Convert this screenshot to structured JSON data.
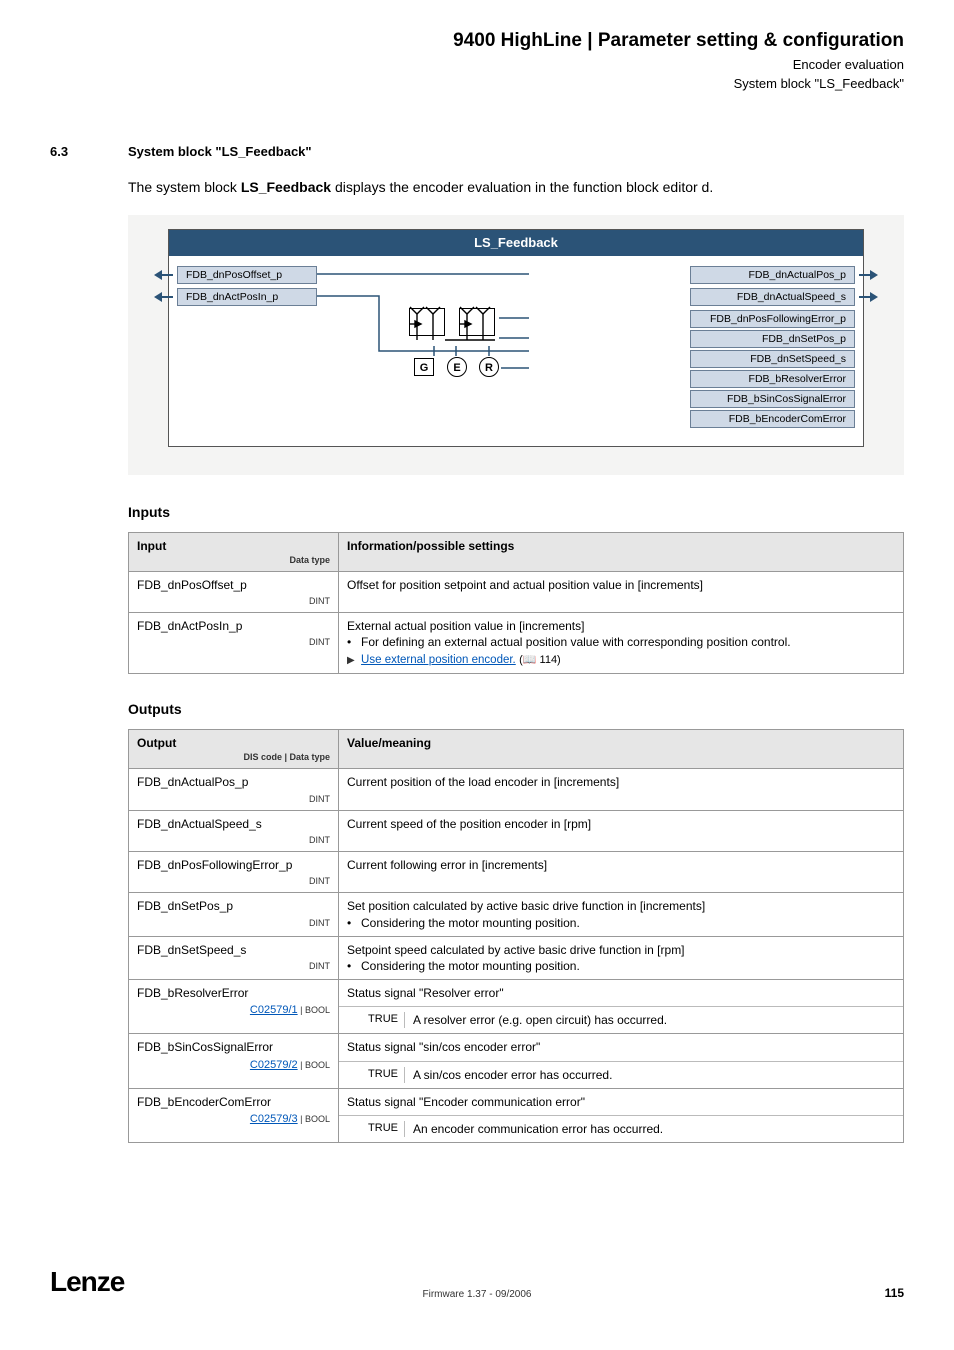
{
  "header": {
    "title": "9400 HighLine | Parameter setting & configuration",
    "subtitle1": "Encoder evaluation",
    "subtitle2": "System block \"LS_Feedback\""
  },
  "section": {
    "number": "6.3",
    "heading": "System block \"LS_Feedback\""
  },
  "intro": {
    "pre": "The system block ",
    "bold": "LS_Feedback",
    "post": " displays the encoder evaluation in the function block editor d."
  },
  "diagram": {
    "title": "LS_Feedback",
    "inputs": [
      "FDB_dnPosOffset_p",
      "FDB_dnActPosIn_p"
    ],
    "outputs": [
      "FDB_dnActualPos_p",
      "FDB_dnActualSpeed_s",
      "FDB_dnPosFollowingError_p",
      "FDB_dnSetPos_p",
      "FDB_dnSetSpeed_s",
      "FDB_bResolverError",
      "FDB_bSinCosSignalError",
      "FDB_bEncoderComError"
    ],
    "ger": [
      "G",
      "E",
      "R"
    ]
  },
  "inputs_head": "Inputs",
  "inputs_table": {
    "h1": "Input",
    "h1sub": "Data type",
    "h2": "Information/possible settings",
    "rows": [
      {
        "name": "FDB_dnPosOffset_p",
        "dtype": "DINT",
        "info_plain": "Offset for position setpoint and actual position value in [increments]"
      },
      {
        "name": "FDB_dnActPosIn_p",
        "dtype": "DINT",
        "info_line1": "External actual position value in [increments]",
        "info_bullet": "For defining an external actual position value with corresponding position control.",
        "info_link": "Use external position encoder.",
        "info_link_page": "(📖 114)"
      }
    ]
  },
  "outputs_head": "Outputs",
  "outputs_table": {
    "h1": "Output",
    "h1sub": "DIS code | Data type",
    "h2": "Value/meaning",
    "rows": [
      {
        "name": "FDB_dnActualPos_p",
        "dtype": "DINT",
        "val": "Current position of the load encoder in [increments]"
      },
      {
        "name": "FDB_dnActualSpeed_s",
        "dtype": "DINT",
        "val": "Current speed of the position encoder in [rpm]"
      },
      {
        "name": "FDB_dnPosFollowingError_p",
        "dtype": "DINT",
        "val": "Current following error in [increments]"
      },
      {
        "name": "FDB_dnSetPos_p",
        "dtype": "DINT",
        "val": "Set position calculated by active basic drive function in [increments]",
        "bullet": "Considering the motor mounting position."
      },
      {
        "name": "FDB_dnSetSpeed_s",
        "dtype": "DINT",
        "val": "Setpoint speed calculated by active basic drive function in [rpm]",
        "bullet": "Considering the motor mounting position."
      },
      {
        "name": "FDB_bResolverError",
        "code": "C02579/1",
        "dtype": "BOOL",
        "status": "Status signal \"Resolver error\"",
        "truelab": "TRUE",
        "truetxt": "A resolver error (e.g. open circuit) has occurred."
      },
      {
        "name": "FDB_bSinCosSignalError",
        "code": "C02579/2",
        "dtype": "BOOL",
        "status": "Status signal \"sin/cos encoder error\"",
        "truelab": "TRUE",
        "truetxt": "A sin/cos encoder error has occurred."
      },
      {
        "name": "FDB_bEncoderComError",
        "code": "C02579/3",
        "dtype": "BOOL",
        "status": "Status signal \"Encoder communication error\"",
        "truelab": "TRUE",
        "truetxt": "An encoder communication error has occurred."
      }
    ]
  },
  "footer": {
    "logo": "Lenze",
    "center": "Firmware 1.37 - 09/2006",
    "page": "115"
  }
}
